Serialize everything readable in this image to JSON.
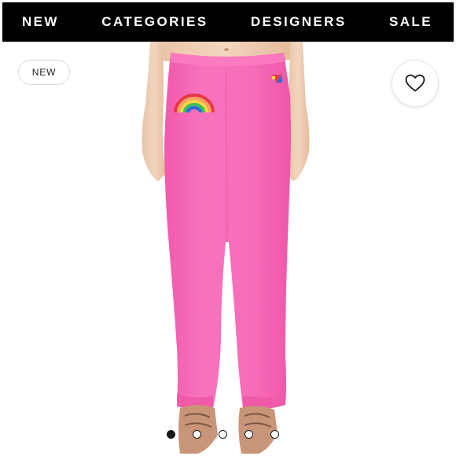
{
  "nav": {
    "items": [
      {
        "label": "NEW"
      },
      {
        "label": "CATEGORIES"
      },
      {
        "label": "DESIGNERS"
      },
      {
        "label": "SALE"
      }
    ]
  },
  "product": {
    "badge": "NEW",
    "wishlist_icon": "heart-outline-icon",
    "image_subject": "pink sweatpants with rainbow patch",
    "colors": {
      "garment": "#f76cb8",
      "nav_bg": "#000000",
      "nav_text": "#ffffff"
    }
  },
  "carousel": {
    "total": 5,
    "active_index": 0
  }
}
